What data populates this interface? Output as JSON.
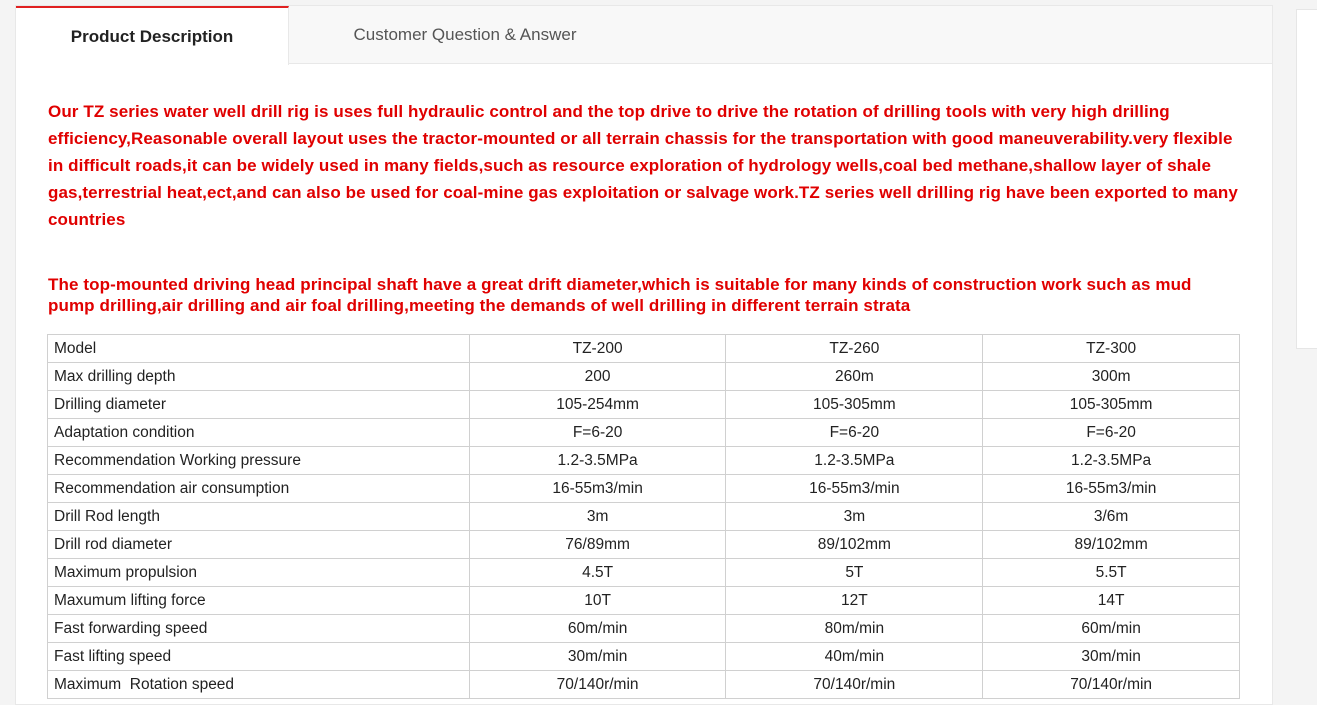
{
  "tabs": {
    "active_label": "Product Description",
    "inactive_label": "Customer Question & Answer"
  },
  "description": {
    "paragraph1": "Our TZ series water well drill rig is uses full hydraulic control and the top drive to drive the rotation of drilling tools with very high drilling efficiency,Reasonable overall layout uses the tractor-mounted or all terrain chassis for the transportation with good maneuverability.very flexible in difficult roads,it can be widely used in many fields,such as resource exploration of hydrology wells,coal bed methane,shallow layer of shale gas,terrestrial heat,ect,and can also be used for coal-mine gas exploitation or salvage work.TZ series well drilling rig have been exported to many countries",
    "paragraph2": "The top-mounted driving head principal shaft have a great drift diameter,which is suitable for many kinds of construction work such as mud pump drilling,air drilling and air foal drilling,meeting the demands of well drilling in different terrain strata"
  },
  "specs": {
    "rows": [
      [
        "Model",
        "TZ-200",
        "TZ-260",
        "TZ-300"
      ],
      [
        "Max drilling depth",
        "200",
        "260m",
        "300m"
      ],
      [
        "Drilling diameter",
        "105-254mm",
        "105-305mm",
        "105-305mm"
      ],
      [
        "Adaptation condition",
        "F=6-20",
        "F=6-20",
        "F=6-20"
      ],
      [
        "Recommendation Working pressure",
        "1.2-3.5MPa",
        "1.2-3.5MPa",
        "1.2-3.5MPa"
      ],
      [
        "Recommendation air consumption",
        "16-55m3/min",
        "16-55m3/min",
        "16-55m3/min"
      ],
      [
        "Drill Rod length",
        "3m",
        "3m",
        "3/6m"
      ],
      [
        "Drill rod diameter",
        "76/89mm",
        "89/102mm",
        "89/102mm"
      ],
      [
        "Maximum propulsion",
        "4.5T",
        "5T",
        "5.5T"
      ],
      [
        "Maxumum lifting force",
        "10T",
        "12T",
        "14T"
      ],
      [
        "Fast forwarding speed",
        "60m/min",
        "80m/min",
        "60m/min"
      ],
      [
        "Fast lifting speed",
        "30m/min",
        "40m/min",
        "30m/min"
      ],
      [
        "Maximum  Rotation speed",
        "70/140r/min",
        "70/140r/min",
        "70/140r/min"
      ]
    ]
  },
  "colors": {
    "accent": "#e02020",
    "description_text": "#e00000"
  }
}
